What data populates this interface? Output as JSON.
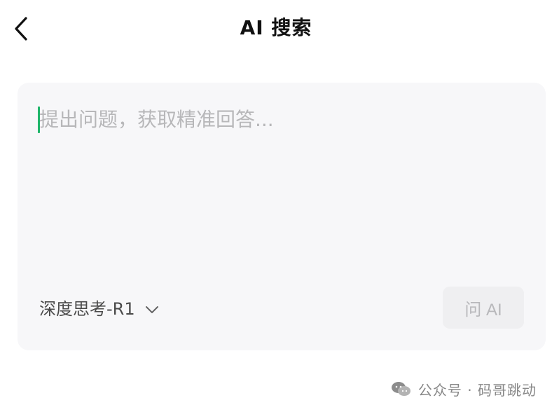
{
  "header": {
    "title": "AI 搜索",
    "back_icon": "chevron-left-icon"
  },
  "search": {
    "placeholder": "提出问题，获取精准回答...",
    "value": ""
  },
  "model_selector": {
    "label": "深度思考-R1",
    "icon": "chevron-down-icon"
  },
  "ask_button": {
    "label": "问 AI",
    "enabled": false
  },
  "watermark": {
    "icon": "wechat-icon",
    "text": "公众号 · 码哥跳动"
  },
  "colors": {
    "card_background": "#f7f7f9",
    "cursor": "#1fb56a",
    "placeholder": "#b7b7b9",
    "button_background": "#efeff1"
  }
}
